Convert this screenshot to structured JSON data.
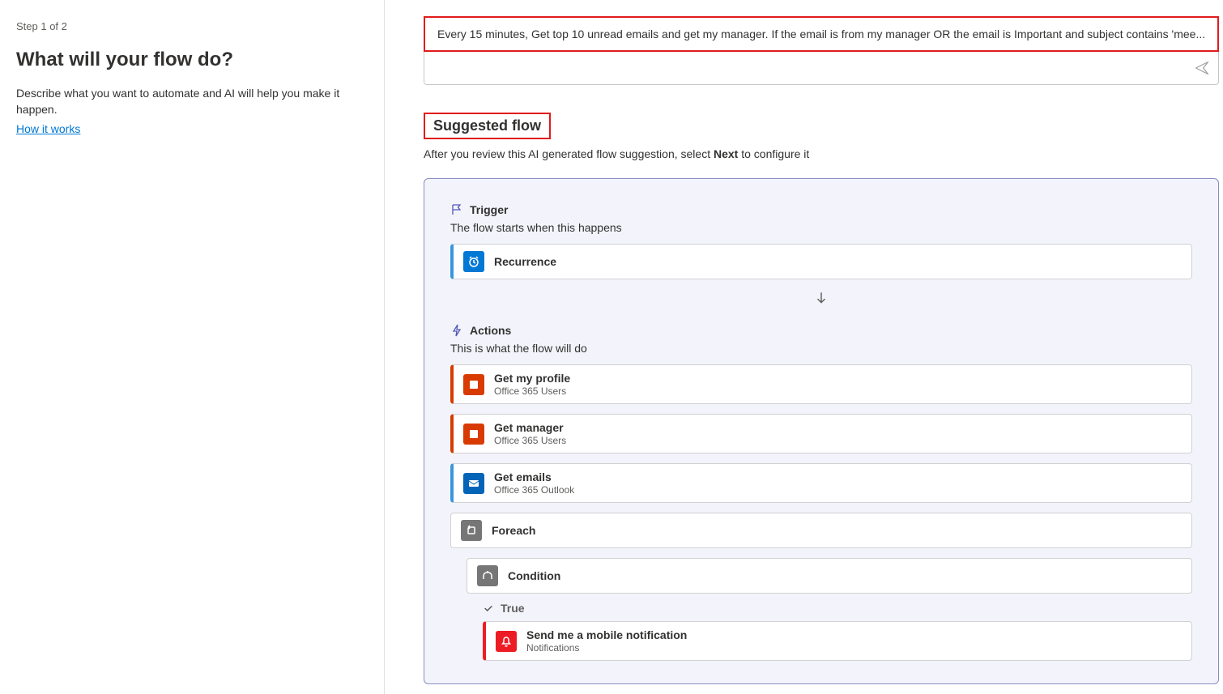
{
  "left": {
    "step_label": "Step 1 of 2",
    "heading": "What will your flow do?",
    "description": "Describe what you want to automate and AI will help you make it happen.",
    "how_link": "How it works"
  },
  "prompt": {
    "text": "Every 15 minutes, Get top 10 unread emails and get my manager. If the email is from my manager OR the email is Important and subject contains 'mee..."
  },
  "suggested": {
    "heading": "Suggested flow",
    "help_prefix": "After you review this AI generated flow suggestion, select ",
    "help_bold": "Next",
    "help_suffix": " to configure it"
  },
  "trigger": {
    "label": "Trigger",
    "sub": "The flow starts when this happens",
    "card_title": "Recurrence"
  },
  "actions": {
    "label": "Actions",
    "sub": "This is what the flow will do",
    "items": [
      {
        "title": "Get my profile",
        "sub": "Office 365 Users"
      },
      {
        "title": "Get manager",
        "sub": "Office 365 Users"
      },
      {
        "title": "Get emails",
        "sub": "Office 365 Outlook"
      }
    ],
    "foreach_title": "Foreach",
    "condition_title": "Condition",
    "true_label": "True",
    "notify_title": "Send me a mobile notification",
    "notify_sub": "Notifications"
  }
}
